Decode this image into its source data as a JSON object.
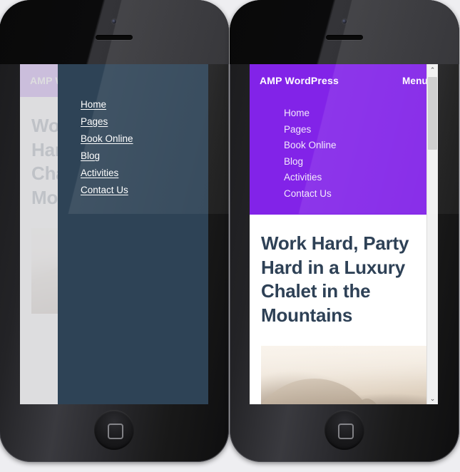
{
  "site": {
    "brand": "AMP WordPress",
    "menu_toggle_label": "Menu",
    "nav_items": [
      {
        "label": "Home"
      },
      {
        "label": "Pages"
      },
      {
        "label": "Book Online"
      },
      {
        "label": "Blog"
      },
      {
        "label": "Activities"
      },
      {
        "label": "Contact Us"
      }
    ],
    "article": {
      "headline": "Work Hard, Party Hard in a Luxury Chalet in the Mountains"
    }
  },
  "left_phone": {
    "drawer_nav_items": [
      {
        "label": "Home"
      },
      {
        "label": "Pages"
      },
      {
        "label": "Book Online"
      },
      {
        "label": "Blog"
      },
      {
        "label": "Activities"
      },
      {
        "label": "Contact Us"
      }
    ]
  },
  "scrollbar": {
    "up_arrow": "⌃",
    "down_arrow": "⌄"
  },
  "colors": {
    "brand_purple": "#8223e8",
    "drawer_slate": "#2e4356",
    "headline_text": "#2e4156",
    "screen_background": "#ffffff",
    "scrollbar_track": "#f1f1f1",
    "scrollbar_thumb": "#cdcdcd"
  }
}
